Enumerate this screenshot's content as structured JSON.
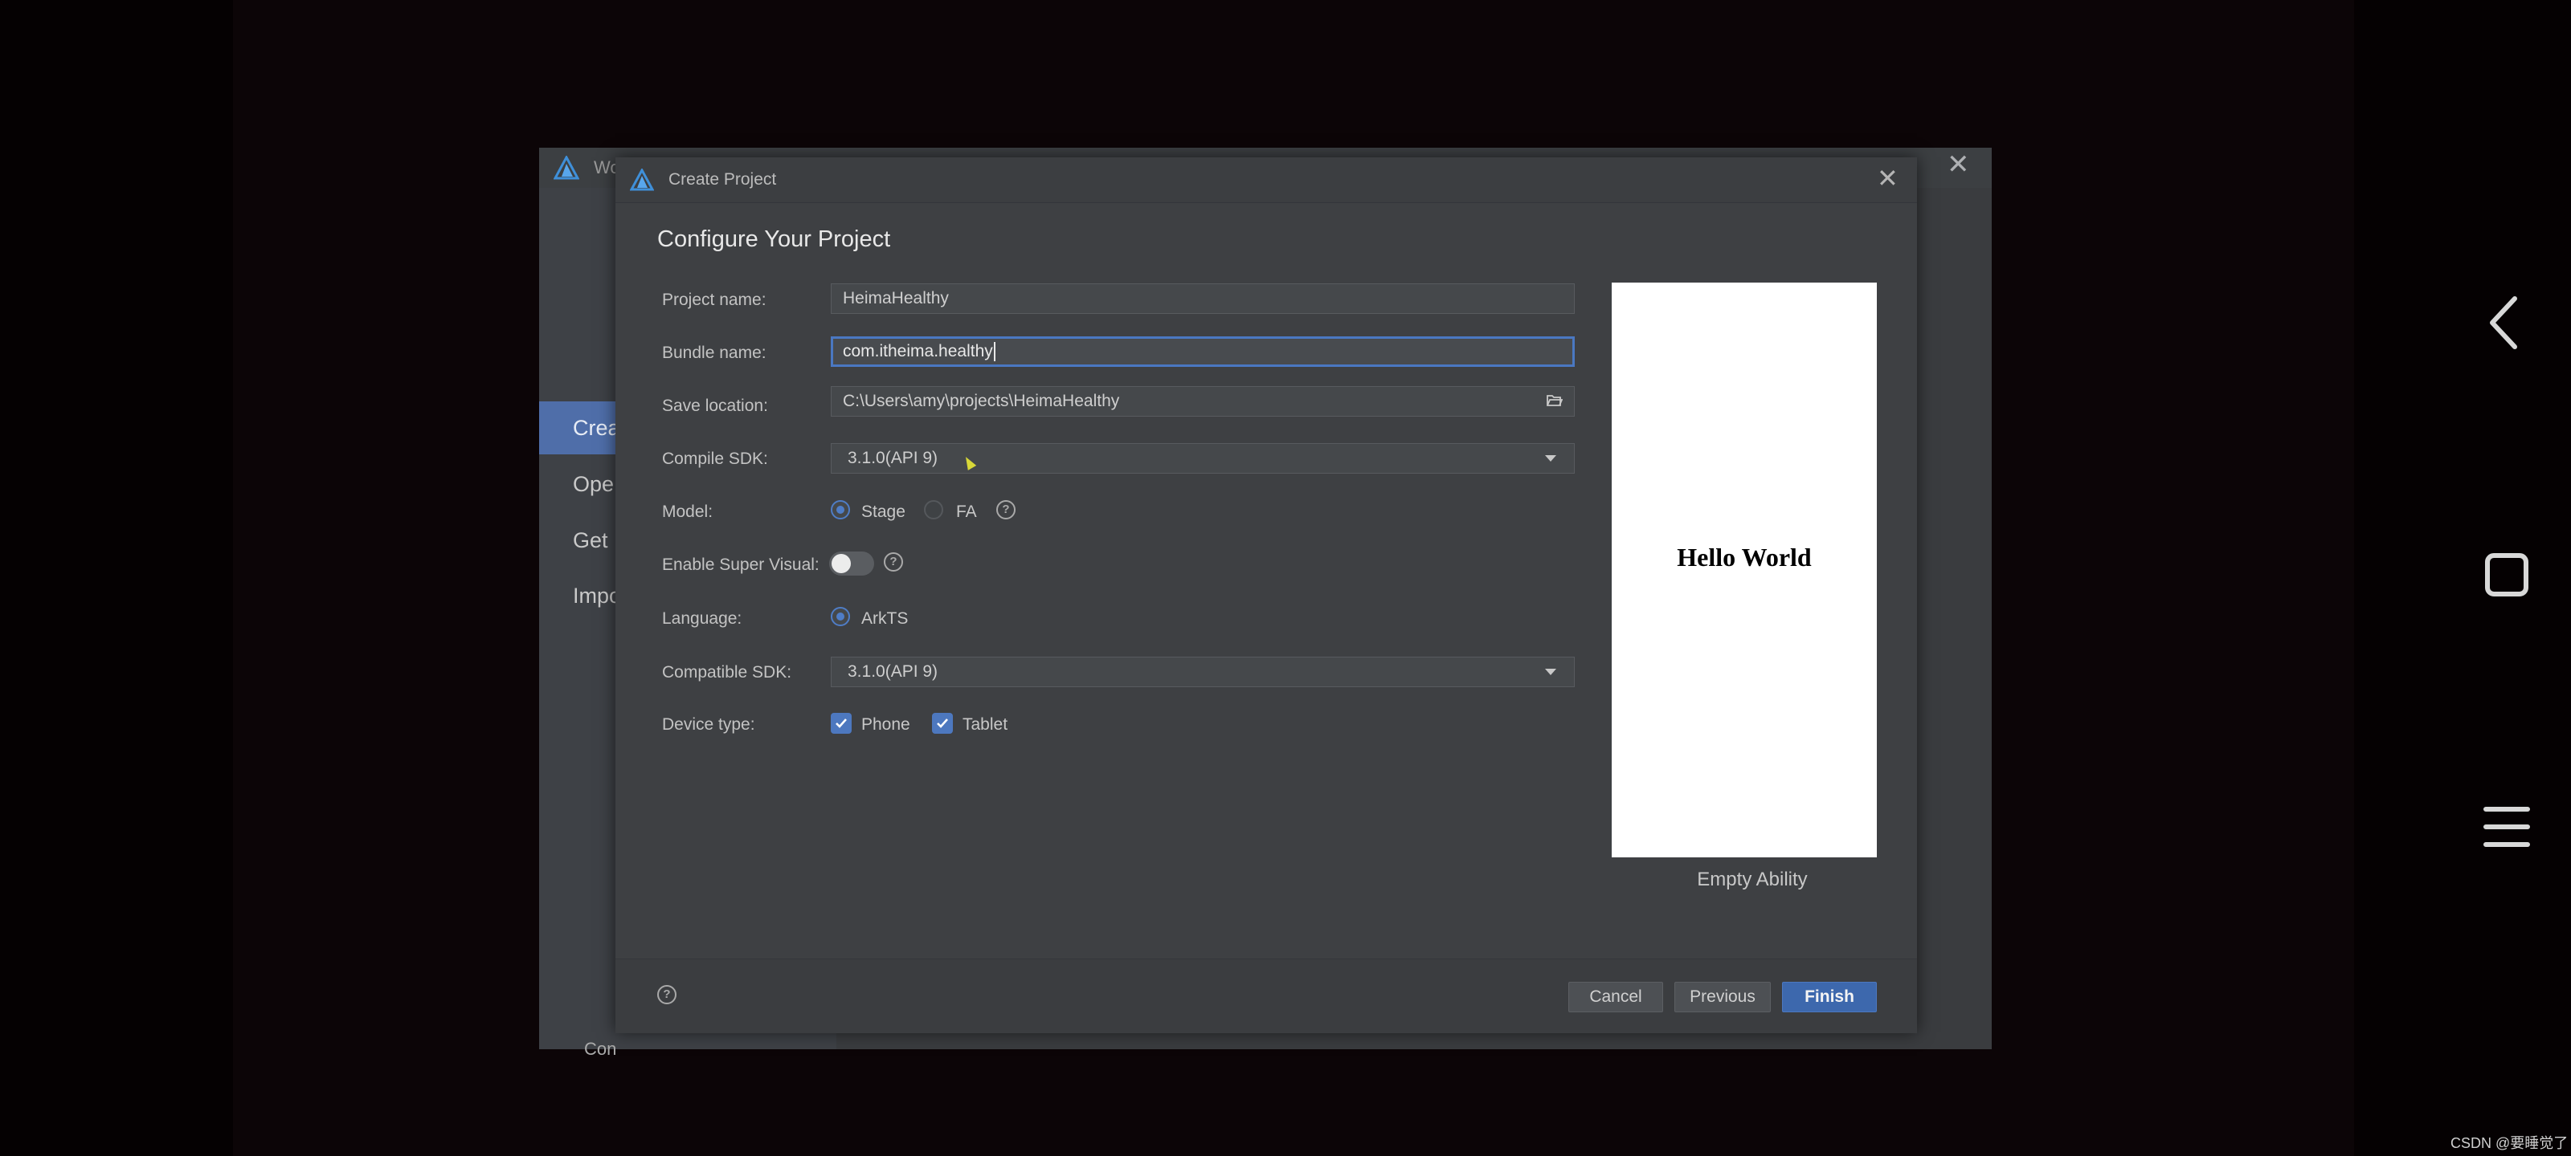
{
  "background_window": {
    "title": "Wo",
    "sidebar_items": [
      {
        "label": "Crea",
        "active": true
      },
      {
        "label": "Ope",
        "active": false
      },
      {
        "label": "Get",
        "active": false
      },
      {
        "label": "Impo",
        "active": false
      }
    ],
    "bottom_text": "Con"
  },
  "dialog": {
    "title": "Create Project",
    "heading": "Configure Your Project",
    "fields": {
      "project_name": {
        "label": "Project name:",
        "value": "HeimaHealthy"
      },
      "bundle_name": {
        "label": "Bundle name:",
        "value": "com.itheima.healthy"
      },
      "save_location": {
        "label": "Save location:",
        "value": "C:\\Users\\amy\\projects\\HeimaHealthy"
      },
      "compile_sdk": {
        "label": "Compile SDK:",
        "value": "3.1.0(API 9)"
      },
      "model": {
        "label": "Model:",
        "options": [
          "Stage",
          "FA"
        ],
        "selected": "Stage"
      },
      "super_visual": {
        "label": "Enable Super Visual:",
        "enabled": false
      },
      "language": {
        "label": "Language:",
        "value": "ArkTS"
      },
      "compatible_sdk": {
        "label": "Compatible SDK:",
        "value": "3.1.0(API 9)"
      },
      "device_type": {
        "label": "Device type:",
        "options": [
          {
            "label": "Phone",
            "checked": true
          },
          {
            "label": "Tablet",
            "checked": true
          }
        ]
      }
    },
    "preview": {
      "text": "Hello World",
      "template_name": "Empty Ability"
    },
    "buttons": {
      "cancel": "Cancel",
      "previous": "Previous",
      "finish": "Finish"
    },
    "help_symbol": "?"
  },
  "watermark": "CSDN @要睡觉了",
  "colors": {
    "accent": "#4f7dc6",
    "primary_button": "#3d68ad",
    "dialog_bg": "#3e4043"
  }
}
